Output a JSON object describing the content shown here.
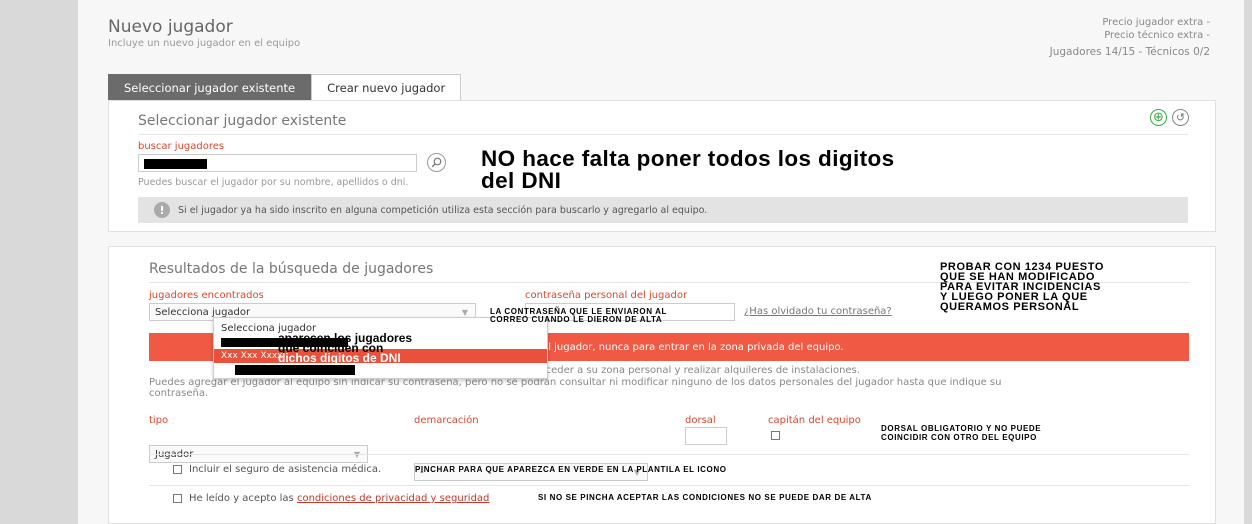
{
  "header": {
    "title": "Nuevo jugador",
    "subtitle": "Incluye un nuevo jugador en el equipo",
    "precio_jugador": "Precio jugador extra -",
    "precio_tecnico": "Precio técnico extra -",
    "counts": "Jugadores 14/15 -  Técnicos 0/2"
  },
  "tabs": [
    {
      "label": "Seleccionar jugador existente"
    },
    {
      "label": "Crear nuevo jugador"
    }
  ],
  "search_panel": {
    "title": "Seleccionar jugador existente",
    "field_label": "buscar jugadores",
    "field_value": "",
    "hint": "Puedes buscar el jugador por su nombre, apellidos o dni.",
    "info": "Si el jugador ya ha sido inscrito en alguna competición utiliza esta sección para buscarlo y agregarlo al equipo.",
    "info_icon": "!",
    "add_icon": "⊕",
    "reset_icon": "↺"
  },
  "results_panel": {
    "title": "Resultados de la búsqueda de jugadores",
    "found_label": "jugadores encontrados",
    "select_value": "Selecciona jugador",
    "dropdown_items": [
      "Selecciona jugador",
      "",
      "Xxx Xxx Xxxx",
      ""
    ],
    "password_label": "contraseña personal del jugador",
    "forgot_link": "¿Has olvidado tu contraseña?",
    "banner_text": "ona privada del jugador, nunca para entrar en la zona privada del equipo.",
    "para_line1": "competiciones, acceder a su zona personal y realizar alquileres de instalaciones.",
    "para_line2": "Puedes agregar el jugador al equipo sin indicar su contraseña, pero no se podrán consultar ni modificar ninguno de los datos personales del jugador hasta que indique su",
    "para_line3": "contraseña.",
    "tipo_label": "tipo",
    "tipo_value": "Jugador",
    "demarcacion_label": "demarcación",
    "demarcacion_value": "-",
    "dorsal_label": "dorsal",
    "capitan_label": "capitán del equipo",
    "seguro_label": "Incluir el seguro de asistencia médica.",
    "acepto_prefix": "He leído y acepto las ",
    "acepto_link": "condiciones de privacidad y seguridad"
  },
  "annotations": {
    "dni_line1": "NO hace falta poner todos los digitos",
    "dni_line2": "del DNI",
    "probar": [
      "PROBAR CON 1234 PUESTO",
      "QUE SE HAN MODIFICADO",
      "PARA EVITAR INCIDENCIAS",
      "Y LUEGO PONER LA QUE",
      "QUERAMOS PERSONAL"
    ],
    "contrasena": [
      "LA CONTRASEÑA QUE LE ENVIARON AL",
      "CORREO CUANDO LE DIERON DE ALTA"
    ],
    "aparecen": [
      "aparecen los jugadores",
      "que coinciden con",
      "dichos digitos de DNI"
    ],
    "dorsal": [
      "DORSAL OBLIGATORIO Y NO PUEDE",
      "COINCIDIR CON OTRO DEL EQUIPO"
    ],
    "pinchar": "PINCHAR PARA QUE APAREZCA EN VERDE EN LA PLANTILA EL ICONO",
    "condiciones": "SI NO SE PINCHA ACEPTAR LAS CONDICIONES NO SE PUEDE DAR DE ALTA"
  },
  "colors": {
    "accent": "#d8482e",
    "banner": "#f05a45",
    "add_icon": "#3aa845"
  }
}
